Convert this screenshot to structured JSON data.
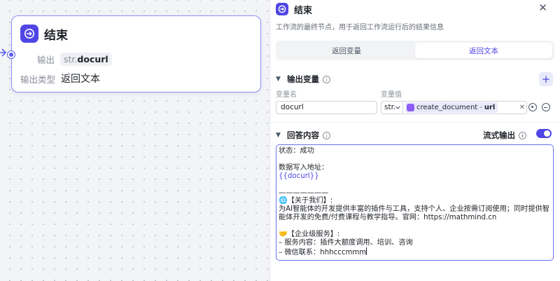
{
  "canvas": {
    "node": {
      "title": "结束",
      "output_label": "输出",
      "output_prefix": "str.",
      "output_value": "docurl",
      "output_type_label": "输出类型",
      "output_type_value": "返回文本"
    }
  },
  "panel": {
    "title": "结束",
    "description": "工作流的最终节点，用于返回工作流运行后的结果信息",
    "tabs": [
      {
        "label": "返回变量",
        "active": false
      },
      {
        "label": "返回文本",
        "active": true
      }
    ],
    "output_section": {
      "title": "输出变量",
      "col_name": "变量名",
      "col_value": "变量值",
      "variable_name": "docurl",
      "variable_type": "str.",
      "ref_node": "create_document",
      "ref_sep": "-",
      "ref_field": "url"
    },
    "answer_section": {
      "title": "回答内容",
      "stream_label": "流式输出",
      "stream_enabled": true,
      "lines": [
        "状态：成功",
        "",
        "数据写入地址：",
        "{{docurl}}",
        "",
        "———————",
        "🌐【关于我们】:",
        "为AI智能体的开发提供丰富的插件与工具，支持个人、企业按需订阅使用；同时提供智能体开发的免费/付费课程与教学指导。官网：https://mathmind.cn",
        "",
        "🤝【企业级服务】:",
        "– 服务内容：插件大额度调用、培训、咨询",
        "– 微信联系：hhhcccmmm"
      ]
    }
  },
  "icons": {
    "node": "exit-icon",
    "close": "close-icon",
    "info": "info-icon",
    "add": "plus-icon",
    "target": "target-icon",
    "remove": "minus-circle-icon"
  },
  "colors": {
    "accent": "#4f46e5",
    "node_border": "#8d8ef3"
  }
}
